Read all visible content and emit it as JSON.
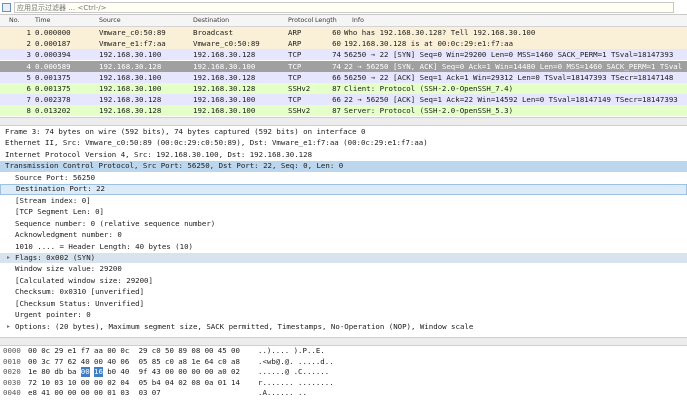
{
  "colors": {
    "arp": "#faf0d7",
    "tcp": "#e7e6ff",
    "ssh": "#e4ffc7",
    "selected_row": "#a0a0a0",
    "selected_proto": "#bcd6ee",
    "hex_highlight": "#3e7fc5"
  },
  "filter": {
    "placeholder": "应用显示过滤器 … <Ctrl-/>"
  },
  "columns": [
    "No.",
    "Time",
    "Source",
    "Destination",
    "Protocol",
    "Length",
    "Info"
  ],
  "packets": [
    {
      "no": "1",
      "time": "0.000000",
      "src": "Vmware_c0:50:89",
      "dst": "Broadcast",
      "proto": "ARP",
      "len": "60",
      "info": "Who has 192.168.30.128? Tell 192.168.30.100",
      "kind": "arp",
      "selected": false
    },
    {
      "no": "2",
      "time": "0.000187",
      "src": "Vmware_e1:f7:aa",
      "dst": "Vmware_c0:50:89",
      "proto": "ARP",
      "len": "60",
      "info": "192.168.30.128 is at 00:0c:29:e1:f7:aa",
      "kind": "arp",
      "selected": false
    },
    {
      "no": "3",
      "time": "0.000394",
      "src": "192.168.30.100",
      "dst": "192.168.30.128",
      "proto": "TCP",
      "len": "74",
      "info": "56250 → 22 [SYN] Seq=0 Win=29200 Len=0 MSS=1460 SACK_PERM=1 TSval=18147393",
      "kind": "tcp",
      "selected": false
    },
    {
      "no": "4",
      "time": "0.000589",
      "src": "192.168.30.128",
      "dst": "192.168.30.100",
      "proto": "TCP",
      "len": "74",
      "info": "22 → 56250 [SYN, ACK] Seq=0 Ack=1 Win=14480 Len=0 MSS=1460 SACK_PERM=1 TSval",
      "kind": "tcp",
      "selected": true
    },
    {
      "no": "5",
      "time": "0.001375",
      "src": "192.168.30.100",
      "dst": "192.168.30.128",
      "proto": "TCP",
      "len": "66",
      "info": "56250 → 22 [ACK] Seq=1 Ack=1 Win=29312 Len=0 TSval=18147393 TSecr=18147148",
      "kind": "tcp",
      "selected": false
    },
    {
      "no": "6",
      "time": "0.001375",
      "src": "192.168.30.100",
      "dst": "192.168.30.128",
      "proto": "SSHv2",
      "len": "87",
      "info": "Client: Protocol (SSH-2.0-OpenSSH_7.4)",
      "kind": "ssh",
      "selected": false
    },
    {
      "no": "7",
      "time": "0.002378",
      "src": "192.168.30.128",
      "dst": "192.168.30.100",
      "proto": "TCP",
      "len": "66",
      "info": "22 → 56250 [ACK] Seq=1 Ack=22 Win=14592 Len=0 TSval=18147149 TSecr=18147393",
      "kind": "tcp",
      "selected": false
    },
    {
      "no": "8",
      "time": "0.013202",
      "src": "192.168.30.128",
      "dst": "192.168.30.100",
      "proto": "SSHv2",
      "len": "87",
      "info": "Server: Protocol (SSH-2.0-OpenSSH_5.3)",
      "kind": "ssh",
      "selected": false
    }
  ],
  "details": [
    {
      "text": "Frame 3: 74 bytes on wire (592 bits), 74 bytes captured (592 bits) on interface 0",
      "indent": 0,
      "state": "collapsed",
      "style": "normal"
    },
    {
      "text": "Ethernet II, Src: Vmware_c0:50:89 (00:0c:29:c0:50:89), Dst: Vmware_e1:f7:aa (00:0c:29:e1:f7:aa)",
      "indent": 0,
      "state": "collapsed",
      "style": "normal"
    },
    {
      "text": "Internet Protocol Version 4, Src: 192.168.30.100, Dst: 192.168.30.128",
      "indent": 0,
      "state": "collapsed",
      "style": "normal"
    },
    {
      "text": "Transmission Control Protocol, Src Port: 56250, Dst Port: 22, Seq: 0, Len: 0",
      "indent": 0,
      "state": "expanded",
      "style": "sel-proto"
    },
    {
      "text": "Source Port: 56250",
      "indent": 1,
      "state": "leaf",
      "style": "normal"
    },
    {
      "text": "Destination Port: 22",
      "indent": 1,
      "state": "leaf",
      "style": "sel-field"
    },
    {
      "text": "[Stream index: 0]",
      "indent": 1,
      "state": "leaf",
      "style": "normal"
    },
    {
      "text": "[TCP Segment Len: 0]",
      "indent": 1,
      "state": "leaf",
      "style": "normal"
    },
    {
      "text": "Sequence number: 0    (relative sequence number)",
      "indent": 1,
      "state": "leaf",
      "style": "normal"
    },
    {
      "text": "Acknowledgment number: 0",
      "indent": 1,
      "state": "leaf",
      "style": "normal"
    },
    {
      "text": "1010 .... = Header Length: 40 bytes (10)",
      "indent": 1,
      "state": "leaf",
      "style": "normal"
    },
    {
      "text": "Flags: 0x002 (SYN)",
      "indent": 1,
      "state": "collapsed",
      "style": "hl-flags"
    },
    {
      "text": "Window size value: 29200",
      "indent": 1,
      "state": "leaf",
      "style": "normal"
    },
    {
      "text": "[Calculated window size: 29200]",
      "indent": 1,
      "state": "leaf",
      "style": "normal"
    },
    {
      "text": "Checksum: 0x0310 [unverified]",
      "indent": 1,
      "state": "leaf",
      "style": "normal"
    },
    {
      "text": "[Checksum Status: Unverified]",
      "indent": 1,
      "state": "leaf",
      "style": "normal"
    },
    {
      "text": "Urgent pointer: 0",
      "indent": 1,
      "state": "leaf",
      "style": "normal"
    },
    {
      "text": "Options: (20 bytes), Maximum segment size, SACK permitted, Timestamps, No-Operation (NOP), Window scale",
      "indent": 1,
      "state": "collapsed",
      "style": "normal"
    }
  ],
  "hex": [
    {
      "offset": "0000",
      "bytes": [
        "00",
        "0c",
        "29",
        "e1",
        "f7",
        "aa",
        "00",
        "0c",
        "29",
        "c0",
        "50",
        "89",
        "08",
        "00",
        "45",
        "00"
      ],
      "ascii": "..)....  ).P..E.",
      "hl": []
    },
    {
      "offset": "0010",
      "bytes": [
        "00",
        "3c",
        "77",
        "62",
        "40",
        "00",
        "40",
        "06",
        "05",
        "85",
        "c0",
        "a8",
        "1e",
        "64",
        "c0",
        "a8"
      ],
      "ascii": ".<wb@.@. .....d..",
      "hl": []
    },
    {
      "offset": "0020",
      "bytes": [
        "1e",
        "80",
        "db",
        "ba",
        "00",
        "16",
        "b0",
        "40",
        "9f",
        "43",
        "00",
        "00",
        "00",
        "00",
        "a0",
        "02"
      ],
      "ascii": "......@ .C......",
      "hl": [
        4,
        5
      ]
    },
    {
      "offset": "0030",
      "bytes": [
        "72",
        "10",
        "03",
        "10",
        "00",
        "00",
        "02",
        "04",
        "05",
        "b4",
        "04",
        "02",
        "08",
        "0a",
        "01",
        "14"
      ],
      "ascii": "r....... ........",
      "hl": []
    },
    {
      "offset": "0040",
      "bytes": [
        "e8",
        "41",
        "00",
        "00",
        "00",
        "00",
        "01",
        "03",
        "03",
        "07"
      ],
      "ascii": ".A......  ..",
      "hl": []
    }
  ]
}
